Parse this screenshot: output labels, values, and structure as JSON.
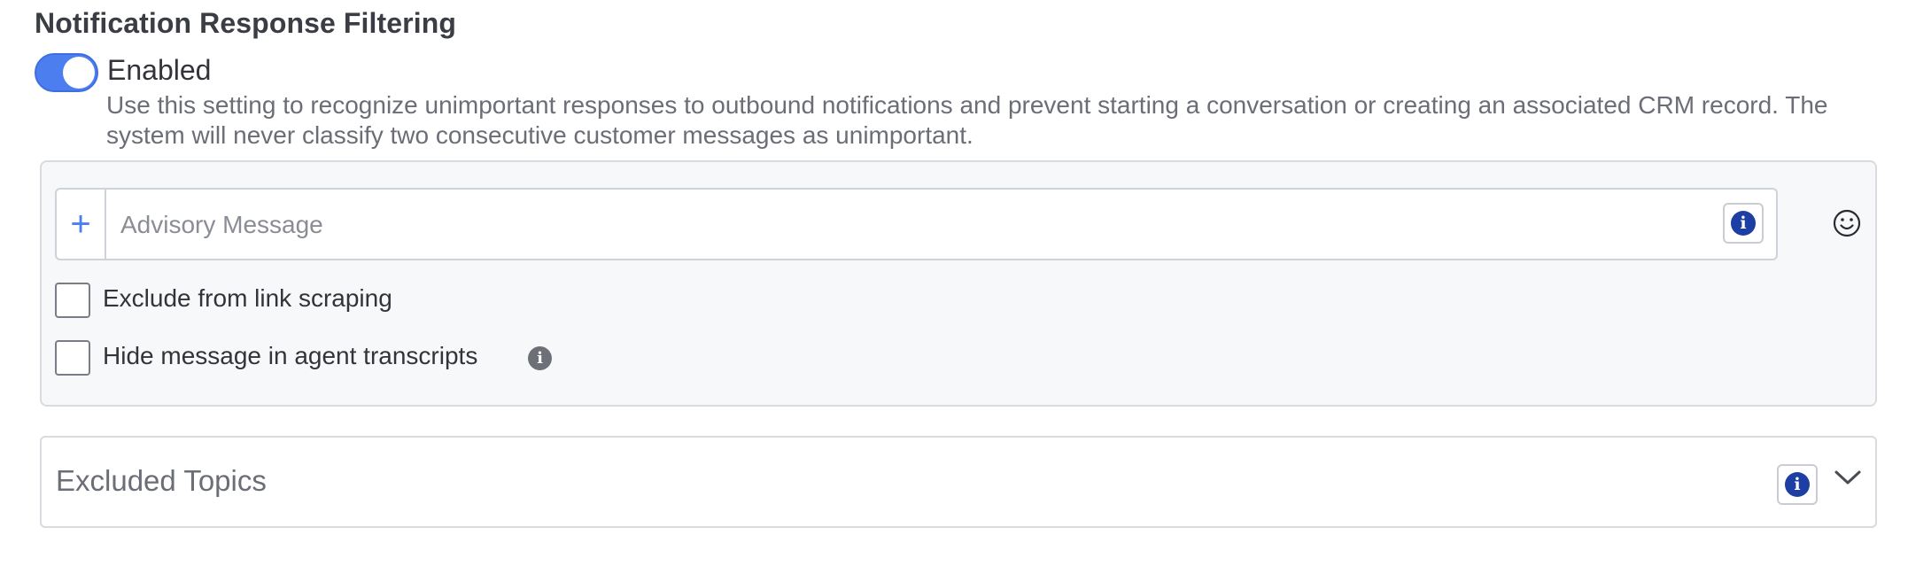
{
  "section": {
    "title": "Notification Response Filtering",
    "toggle": {
      "label": "Enabled",
      "on": true
    },
    "description": "Use this setting to recognize unimportant responses to outbound notifications and prevent starting a conversation or creating an associated CRM record. The system will never classify two consecutive customer messages as unimportant."
  },
  "advisory": {
    "add_icon": "+",
    "input": {
      "placeholder": "Advisory Message",
      "value": ""
    },
    "info_icon": "i",
    "emoji_icon": "smiley-icon"
  },
  "checkboxes": [
    {
      "label": "Exclude from link scraping",
      "checked": false
    },
    {
      "label": "Hide message in agent transcripts",
      "checked": false,
      "has_info": true
    }
  ],
  "excluded_topics": {
    "label": "Excluded Topics",
    "info_icon": "i",
    "expand_icon": "chevron-down-icon"
  },
  "colors": {
    "accent": "#4d7ef0",
    "info_icon": "#1d3ea3",
    "panel_bg": "#f7f8fa",
    "border": "#d9dbe0"
  }
}
